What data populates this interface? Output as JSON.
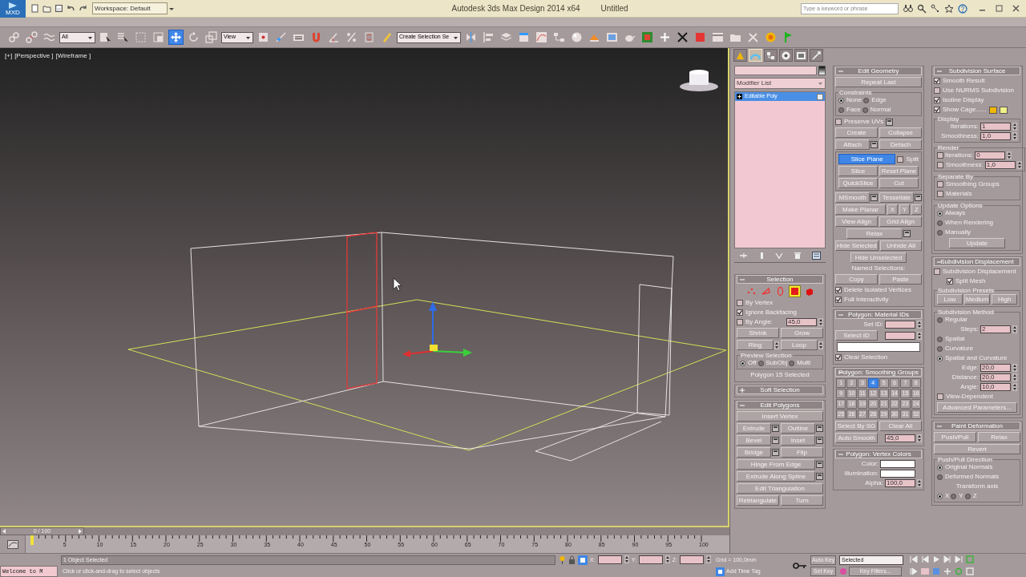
{
  "title_bar": {
    "app_label": "MXD",
    "workspace": "Workspace: Default",
    "title": "Autodesk 3ds Max Design 2014 x64",
    "document": "Untitled",
    "search_placeholder": "Type a keyword or phrase"
  },
  "toolbar": {
    "selection_filter": "All",
    "reference_coord": "View",
    "named_selection": "Create Selection Se"
  },
  "viewport": {
    "labels": [
      "[+]",
      "[Perspective ]",
      "[Wireframe ]"
    ]
  },
  "command_panel": {
    "tabs": [
      {
        "selected": false
      },
      {
        "selected": true
      },
      {
        "selected": false
      },
      {
        "selected": false
      },
      {
        "selected": false
      },
      {
        "selected": false
      }
    ],
    "modifier_list": "Modifier List",
    "stack": [
      {
        "label": "Editable Poly",
        "selected": true
      }
    ],
    "columns": [
      {
        "rollouts": [
          {
            "title": "Selection",
            "expanded": true,
            "controls": [
              {
                "kind": "subobjects",
                "items": [
                  {
                    "selected": false
                  },
                  {
                    "selected": false
                  },
                  {
                    "selected": false
                  },
                  {
                    "selected": true
                  },
                  {
                    "selected": false
                  }
                ]
              },
              {
                "kind": "checkbox",
                "label": "By Vertex",
                "checked": false
              },
              {
                "kind": "checkbox",
                "label": "Ignore Backfacing",
                "checked": true
              },
              {
                "kind": "row",
                "items": [
                  {
                    "kind": "checkbox",
                    "label": "By Angle:",
                    "checked": false
                  },
                  {
                    "kind": "spinner",
                    "value": "45,0"
                  }
                ]
              },
              {
                "kind": "row",
                "items": [
                  {
                    "kind": "button",
                    "label": "Shrink"
                  },
                  {
                    "kind": "button",
                    "label": "Grow"
                  }
                ]
              },
              {
                "kind": "row",
                "items": [
                  {
                    "kind": "button",
                    "label": "Ring",
                    "spin": true
                  },
                  {
                    "kind": "button",
                    "label": "Loop",
                    "spin": true
                  }
                ]
              },
              {
                "kind": "group",
                "title": "Preview Selection",
                "items": [
                  {
                    "kind": "row",
                    "items": [
                      {
                        "kind": "radio",
                        "label": "Off",
                        "selected": true
                      },
                      {
                        "kind": "radio",
                        "label": "SubObj",
                        "selected": false
                      },
                      {
                        "kind": "radio",
                        "label": "Multi",
                        "selected": false
                      }
                    ]
                  }
                ]
              },
              {
                "kind": "text",
                "text": "Polygon 15 Selected"
              }
            ]
          },
          {
            "title": "Soft Selection",
            "expanded": false
          },
          {
            "title": "Edit Polygons",
            "expanded": true,
            "controls": [
              {
                "kind": "button",
                "label": "Insert Vertex"
              },
              {
                "kind": "row",
                "items": [
                  {
                    "kind": "button",
                    "label": "Extrude",
                    "options": true
                  },
                  {
                    "kind": "button",
                    "label": "Outline",
                    "options": true
                  }
                ]
              },
              {
                "kind": "row",
                "items": [
                  {
                    "kind": "button",
                    "label": "Bevel",
                    "options": true
                  },
                  {
                    "kind": "button",
                    "label": "Inset",
                    "options": true
                  }
                ]
              },
              {
                "kind": "row",
                "items": [
                  {
                    "kind": "button",
                    "label": "Bridge",
                    "options": true
                  },
                  {
                    "kind": "button",
                    "label": "Flip"
                  }
                ]
              },
              {
                "kind": "button",
                "label": "Hinge From Edge",
                "options": true
              },
              {
                "kind": "button",
                "label": "Extrude Along Spline",
                "options": true
              },
              {
                "kind": "button",
                "label": "Edit Triangulation"
              },
              {
                "kind": "row",
                "items": [
                  {
                    "kind": "button",
                    "label": "Retriangulate"
                  },
                  {
                    "kind": "button",
                    "label": "Turn"
                  }
                ]
              }
            ]
          }
        ]
      },
      {
        "rollouts": [
          {
            "title": "Edit Geometry",
            "expanded": true,
            "controls": [
              {
                "kind": "button",
                "label": "Repeat Last"
              },
              {
                "kind": "group",
                "title": "Constraints",
                "items": [
                  {
                    "kind": "row",
                    "items": [
                      {
                        "kind": "radio",
                        "label": "None",
                        "selected": true
                      },
                      {
                        "kind": "radio",
                        "label": "Edge",
                        "selected": false
                      }
                    ]
                  },
                  {
                    "kind": "row",
                    "items": [
                      {
                        "kind": "radio",
                        "label": "Face",
                        "selected": false
                      },
                      {
                        "kind": "radio",
                        "label": "Normal",
                        "selected": false
                      }
                    ]
                  }
                ]
              },
              {
                "kind": "checkbox",
                "label": "Preserve UVs",
                "checked": false,
                "options": true
              },
              {
                "kind": "row",
                "items": [
                  {
                    "kind": "button",
                    "label": "Create"
                  },
                  {
                    "kind": "button",
                    "label": "Collapse"
                  }
                ]
              },
              {
                "kind": "row",
                "items": [
                  {
                    "kind": "button",
                    "label": "Attach",
                    "options": true
                  },
                  {
                    "kind": "button",
                    "label": "Detach"
                  }
                ]
              },
              {
                "kind": "group",
                "items": [
                  {
                    "kind": "row",
                    "items": [
                      {
                        "kind": "button",
                        "label": "Slice Plane",
                        "on": true
                      },
                      {
                        "kind": "checkbox",
                        "label": "Split",
                        "checked": false
                      }
                    ]
                  },
                  {
                    "kind": "row",
                    "items": [
                      {
                        "kind": "button",
                        "label": "Slice"
                      },
                      {
                        "kind": "button",
                        "label": "Reset Plane"
                      }
                    ]
                  },
                  {
                    "kind": "row",
                    "items": [
                      {
                        "kind": "button",
                        "label": "QuickSlice"
                      },
                      {
                        "kind": "button",
                        "label": "Cut"
                      }
                    ]
                  }
                ]
              },
              {
                "kind": "row",
                "items": [
                  {
                    "kind": "button",
                    "label": "MSmooth",
                    "options": true
                  },
                  {
                    "kind": "button",
                    "label": "Tessellate",
                    "options": true
                  }
                ]
              },
              {
                "kind": "row",
                "items": [
                  {
                    "kind": "button",
                    "label": "Make Planar"
                  },
                  {
                    "kind": "small_button",
                    "label": "X"
                  },
                  {
                    "kind": "small_button",
                    "label": "Y"
                  },
                  {
                    "kind": "small_button",
                    "label": "Z"
                  }
                ]
              },
              {
                "kind": "row",
                "items": [
                  {
                    "kind": "button",
                    "label": "View Align"
                  },
                  {
                    "kind": "button",
                    "label": "Grid Align"
                  }
                ]
              },
              {
                "kind": "center_button",
                "label": "Relax",
                "options": true
              },
              {
                "kind": "row",
                "items": [
                  {
                    "kind": "button",
                    "label": "Hide Selected"
                  },
                  {
                    "kind": "button",
                    "label": "Unhide All"
                  }
                ]
              },
              {
                "kind": "center_button",
                "label": "Hide Unselected"
              },
              {
                "kind": "text",
                "text": "Named Selections:"
              },
              {
                "kind": "row",
                "items": [
                  {
                    "kind": "button",
                    "label": "Copy"
                  },
                  {
                    "kind": "button",
                    "label": "Paste"
                  }
                ]
              },
              {
                "kind": "checkbox",
                "label": "Delete Isolated Vertices",
                "checked": true
              },
              {
                "kind": "checkbox",
                "label": "Full Interactivity",
                "checked": true
              }
            ]
          },
          {
            "title": "Polygon: Material IDs",
            "expanded": true,
            "controls": [
              {
                "kind": "spinner",
                "label": "Set ID:"
              },
              {
                "kind": "row",
                "items": [
                  {
                    "kind": "button",
                    "label": "Select ID"
                  },
                  {
                    "kind": "spinner"
                  }
                ]
              },
              {
                "kind": "field"
              },
              {
                "kind": "checkbox",
                "label": "Clear Selection",
                "checked": true
              }
            ]
          },
          {
            "title": "Polygon: Smoothing Groups",
            "expanded": true,
            "controls": [
              {
                "kind": "sg_grid",
                "cells": [
                  {
                    "label": "1",
                    "selected": false
                  },
                  {
                    "label": "2",
                    "selected": false
                  },
                  {
                    "label": "3",
                    "selected": false
                  },
                  {
                    "label": "4",
                    "selected": true
                  },
                  {
                    "label": "5",
                    "selected": false
                  },
                  {
                    "label": "6",
                    "selected": false
                  },
                  {
                    "label": "7",
                    "selected": false
                  },
                  {
                    "label": "8",
                    "selected": false
                  },
                  {
                    "label": "9",
                    "selected": false
                  },
                  {
                    "label": "10",
                    "selected": false
                  },
                  {
                    "label": "11",
                    "selected": false
                  },
                  {
                    "label": "12",
                    "selected": false
                  },
                  {
                    "label": "13",
                    "selected": false
                  },
                  {
                    "label": "14",
                    "selected": false
                  },
                  {
                    "label": "15",
                    "selected": false
                  },
                  {
                    "label": "16",
                    "selected": false
                  },
                  {
                    "label": "17",
                    "selected": false
                  },
                  {
                    "label": "18",
                    "selected": false
                  },
                  {
                    "label": "19",
                    "selected": false
                  },
                  {
                    "label": "20",
                    "selected": false
                  },
                  {
                    "label": "21",
                    "selected": false
                  },
                  {
                    "label": "22",
                    "selected": false
                  },
                  {
                    "label": "23",
                    "selected": false
                  },
                  {
                    "label": "24",
                    "selected": false
                  },
                  {
                    "label": "25",
                    "selected": false
                  },
                  {
                    "label": "26",
                    "selected": false
                  },
                  {
                    "label": "27",
                    "selected": false
                  },
                  {
                    "label": "28",
                    "selected": false
                  },
                  {
                    "label": "29",
                    "selected": false
                  },
                  {
                    "label": "30",
                    "selected": false
                  },
                  {
                    "label": "31",
                    "selected": false
                  },
                  {
                    "label": "32",
                    "selected": false
                  }
                ]
              },
              {
                "kind": "row",
                "items": [
                  {
                    "kind": "button",
                    "label": "Select By SG"
                  },
                  {
                    "kind": "button",
                    "label": "Clear All"
                  }
                ]
              },
              {
                "kind": "row",
                "items": [
                  {
                    "kind": "button",
                    "label": "Auto Smooth"
                  },
                  {
                    "kind": "spinner",
                    "value": "45,0"
                  }
                ]
              }
            ]
          },
          {
            "title": "Polygon: Vertex Colors",
            "expanded": true,
            "controls": [
              {
                "kind": "color",
                "label": "Color:"
              },
              {
                "kind": "color",
                "label": "Illumination:"
              },
              {
                "kind": "spinner",
                "label": "Alpha:",
                "value": "100,0"
              }
            ]
          }
        ]
      },
      {
        "rollouts": [
          {
            "title": "Subdivision Surface",
            "expanded": true,
            "controls": [
              {
                "kind": "checkbox",
                "label": "Smooth Result",
                "checked": true
              },
              {
                "kind": "checkbox",
                "label": "Use NURMS Subdivision",
                "checked": false
              },
              {
                "kind": "checkbox",
                "label": "Isoline Display",
                "checked": true
              },
              {
                "kind": "cage_checkbox",
                "label": "Show Cage......",
                "checked": true
              },
              {
                "kind": "group",
                "title": "Display",
                "items": [
                  {
                    "kind": "spinner",
                    "label": "Iterations:",
                    "value": "1"
                  },
                  {
                    "kind": "spinner",
                    "label": "Smoothness:",
                    "value": "1,0"
                  }
                ]
              },
              {
                "kind": "group",
                "title": "Render",
                "items": [
                  {
                    "kind": "row",
                    "items": [
                      {
                        "kind": "checkbox",
                        "checked": false
                      },
                      {
                        "kind": "spinner",
                        "label": "Iterations:",
                        "value": "0"
                      }
                    ]
                  },
                  {
                    "kind": "row",
                    "items": [
                      {
                        "kind": "checkbox",
                        "label": "Smoothness:",
                        "checked": false
                      },
                      {
                        "kind": "spinner",
                        "value": "1,0"
                      }
                    ]
                  }
                ]
              },
              {
                "kind": "group",
                "title": "Separate By",
                "items": [
                  {
                    "kind": "checkbox",
                    "label": "Smoothing Groups",
                    "checked": false
                  },
                  {
                    "kind": "checkbox",
                    "label": "Materials",
                    "checked": false
                  }
                ]
              },
              {
                "kind": "group",
                "title": "Update Options",
                "items": [
                  {
                    "kind": "radio",
                    "label": "Always",
                    "selected": true
                  },
                  {
                    "kind": "radio",
                    "label": "When Rendering",
                    "selected": false
                  },
                  {
                    "kind": "radio",
                    "label": "Manually",
                    "selected": false
                  },
                  {
                    "kind": "center_button",
                    "label": "Update"
                  }
                ]
              }
            ]
          },
          {
            "title": "Subdivision Displacement",
            "expanded": true,
            "controls": [
              {
                "kind": "checkbox",
                "label": "Subdivision Displacement",
                "checked": false
              },
              {
                "kind": "sub_checkbox",
                "label": "Split Mesh",
                "checked": true
              },
              {
                "kind": "group",
                "title": "Subdivision Presets",
                "items": [
                  {
                    "kind": "row",
                    "items": [
                      {
                        "kind": "button",
                        "label": "Low"
                      },
                      {
                        "kind": "button",
                        "label": "Medium"
                      },
                      {
                        "kind": "button",
                        "label": "High"
                      }
                    ]
                  }
                ]
              },
              {
                "kind": "group",
                "title": "Subdivision Method",
                "items": [
                  {
                    "kind": "radio",
                    "label": "Regular",
                    "selected": false
                  },
                  {
                    "kind": "spinner",
                    "label": "Steps:",
                    "value": "2"
                  },
                  {
                    "kind": "radio",
                    "label": "Spatial",
                    "selected": false
                  },
                  {
                    "kind": "radio",
                    "label": "Curvature",
                    "selected": false
                  },
                  {
                    "kind": "radio",
                    "label": "Spatial and Curvature",
                    "selected": true
                  },
                  {
                    "kind": "spinner",
                    "label": "Edge:",
                    "value": "20,0"
                  },
                  {
                    "kind": "spinner",
                    "label": "Distance:",
                    "value": "20,0"
                  },
                  {
                    "kind": "spinner",
                    "label": "Angle:",
                    "value": "10,0"
                  },
                  {
                    "kind": "checkbox",
                    "label": "View-Dependent",
                    "checked": false
                  },
                  {
                    "kind": "button",
                    "label": "Advanced Parameters..."
                  }
                ]
              }
            ]
          },
          {
            "title": "Paint Deformation",
            "expanded": true,
            "controls": [
              {
                "kind": "row",
                "items": [
                  {
                    "kind": "button",
                    "label": "Push/Pull"
                  },
                  {
                    "kind": "button",
                    "label": "Relax"
                  }
                ]
              },
              {
                "kind": "button",
                "label": "Revert"
              },
              {
                "kind": "group",
                "title": "Push/Pull Direction",
                "items": [
                  {
                    "kind": "radio",
                    "label": "Original Normals",
                    "selected": true
                  },
                  {
                    "kind": "radio",
                    "label": "Deformed Normals",
                    "selected": false
                  },
                  {
                    "kind": "text",
                    "text": "Transform axis"
                  },
                  {
                    "kind": "row",
                    "items": [
                      {
                        "kind": "radio",
                        "label": "X",
                        "selected": true
                      },
                      {
                        "kind": "radio",
                        "label": "Y",
                        "selected": false
                      },
                      {
                        "kind": "radio",
                        "label": "Z",
                        "selected": false
                      }
                    ]
                  }
                ]
              }
            ]
          }
        ]
      }
    ]
  },
  "timeline": {
    "position": "0 / 100",
    "ruler_labels": [
      "5",
      "10",
      "15",
      "20",
      "25",
      "30",
      "35",
      "40",
      "45",
      "50",
      "55",
      "60",
      "65",
      "70",
      "75",
      "80",
      "85",
      "90",
      "95",
      "100"
    ]
  },
  "status_bar": {
    "listener": "Welcome to M",
    "selection": "1 Object Selected",
    "prompt": "Click or click-and-drag to select objects",
    "coords": [
      {
        "label": "X:"
      },
      {
        "label": "Y:"
      },
      {
        "label": "Z:"
      }
    ],
    "grid": "Grid = 100,0mm",
    "time_tag": "Add Time Tag",
    "auto_key": "Auto Key",
    "key_mode": "Selected",
    "set_key": "Set Key",
    "key_filters": "Key Filters..."
  }
}
